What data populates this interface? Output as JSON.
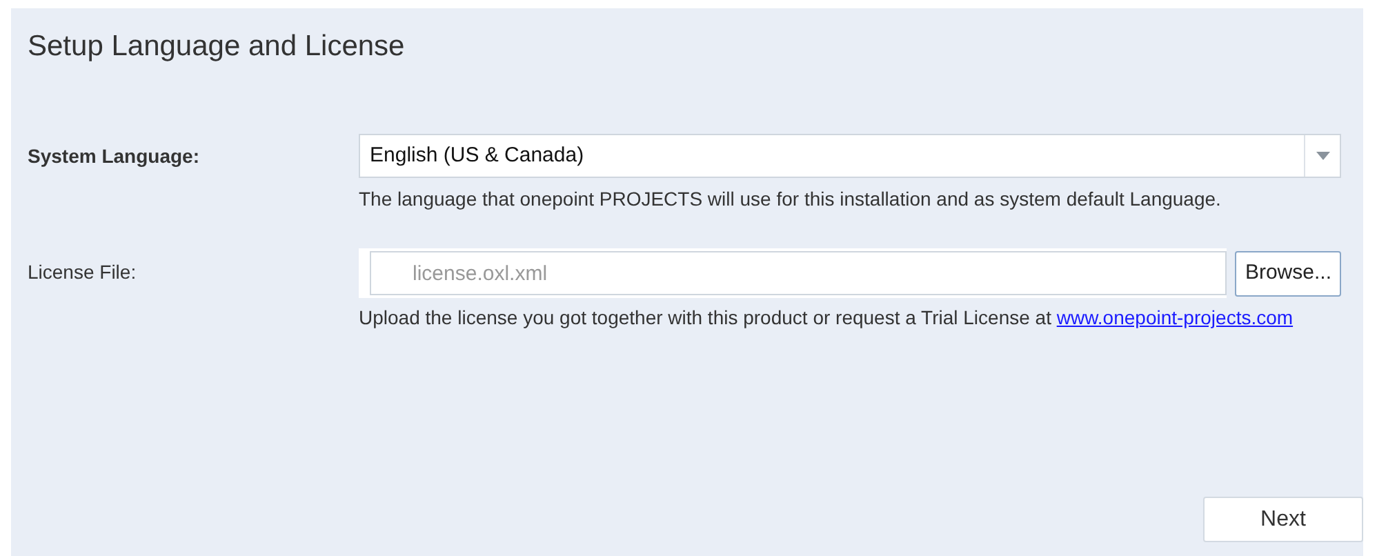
{
  "title": "Setup Language and License",
  "system_language": {
    "label": "System Language:",
    "value": "English (US & Canada)",
    "help": "The language that onepoint PROJECTS will use for this installation and as system default Language."
  },
  "license_file": {
    "label": "License File:",
    "placeholder": "license.oxl.xml",
    "browse_button": "Browse...",
    "help": "Upload the license you got together with this product or request a Trial License at",
    "link": "www.onepoint-projects.com"
  },
  "next_button": "Next"
}
